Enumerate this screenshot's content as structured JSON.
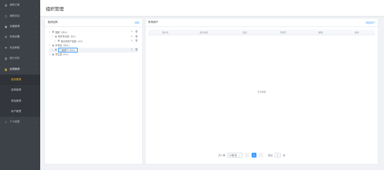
{
  "sidebar": {
    "items": [
      {
        "label": "我的订单",
        "icon": "document-icon"
      },
      {
        "label": "我的评论",
        "icon": "comment-icon"
      },
      {
        "label": "设备管理",
        "icon": "device-icon"
      },
      {
        "label": "系统设置",
        "icon": "settings-icon"
      },
      {
        "label": "安全审核",
        "icon": "shield-icon"
      },
      {
        "label": "统计分析",
        "icon": "chart-icon"
      },
      {
        "label": "权限管理",
        "icon": "lock-icon"
      }
    ],
    "sub_items": [
      {
        "label": "组织管理",
        "active": true
      },
      {
        "label": "菜单管理",
        "active": false
      },
      {
        "label": "角色管理",
        "active": false
      },
      {
        "label": "用户管理",
        "active": false
      }
    ],
    "last_item": {
      "label": "个人信息",
      "icon": "user-icon"
    }
  },
  "header": {
    "title": "组织管理"
  },
  "left_panel": {
    "title": "组织结构",
    "action": "添加",
    "tree": [
      {
        "label": "集团（25人）",
        "level": 0,
        "expanded": true,
        "acts": true
      },
      {
        "label": "软件事业部（8人）",
        "level": 1,
        "expanded": true,
        "acts": true
      },
      {
        "label": "综合系统产品部（4人）",
        "level": 2,
        "expanded": false,
        "acts": true
      },
      {
        "label": "外事处（38人）",
        "level": 0,
        "expanded": true,
        "acts": false
      },
      {
        "label": "二组部门（0人）",
        "level": 1,
        "expanded": false,
        "acts": true,
        "selected": true
      },
      {
        "label": "学生部（0人）",
        "level": 0,
        "expanded": false,
        "acts": false
      }
    ]
  },
  "right_panel": {
    "title": "机构用户",
    "action": "添加用户",
    "columns": [
      "用户名",
      "用户姓名",
      "性别",
      "手机号",
      "邮箱",
      "操作"
    ],
    "empty_text": "暂无数据",
    "pagination": {
      "total": "共 0 条",
      "page_size": "10条/页",
      "current_page": "1",
      "goto_label": "前往",
      "goto_value": "1",
      "page_suffix": "页"
    }
  }
}
